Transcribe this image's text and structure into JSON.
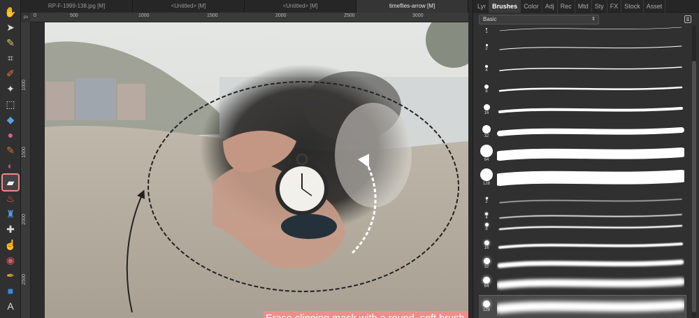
{
  "toolbar": {
    "tools": [
      {
        "name": "view-tool",
        "icon": "hand-icon",
        "glyph": "✋"
      },
      {
        "name": "move-tool",
        "icon": "move-pointer-icon",
        "glyph": "➤"
      },
      {
        "name": "color-picker-tool",
        "icon": "eyedropper-icon",
        "glyph": "✎"
      },
      {
        "name": "crop-tool",
        "icon": "crop-icon",
        "glyph": "⌗"
      },
      {
        "name": "selection-brush-tool",
        "icon": "selection-brush-icon",
        "glyph": "✐"
      },
      {
        "name": "flood-select-tool",
        "icon": "magic-wand-icon",
        "glyph": "✦"
      },
      {
        "name": "marquee-tool",
        "icon": "marquee-icon",
        "glyph": "⬚"
      },
      {
        "name": "flood-fill-tool",
        "icon": "paint-bucket-icon",
        "glyph": "◆"
      },
      {
        "name": "gradient-tool",
        "icon": "gradient-wheel-icon",
        "glyph": "●"
      },
      {
        "name": "paint-brush-tool",
        "icon": "paint-brush-icon",
        "glyph": "✎"
      },
      {
        "name": "color-replacement-tool",
        "icon": "color-replace-icon",
        "glyph": "◐"
      },
      {
        "name": "erase-brush-tool",
        "icon": "eraser-icon",
        "glyph": "▰"
      },
      {
        "name": "burn-tool",
        "icon": "flame-icon",
        "glyph": "♨"
      },
      {
        "name": "clone-tool",
        "icon": "stamp-icon",
        "glyph": "♜"
      },
      {
        "name": "blemish-removal-tool",
        "icon": "bandage-icon",
        "glyph": "✚"
      },
      {
        "name": "smudge-tool",
        "icon": "finger-icon",
        "glyph": "☝"
      },
      {
        "name": "red-eye-tool",
        "icon": "eye-brush-icon",
        "glyph": "◉"
      },
      {
        "name": "pen-tool",
        "icon": "pen-nib-icon",
        "glyph": "✒"
      },
      {
        "name": "shape-tool",
        "icon": "rectangle-shape-icon",
        "glyph": "■"
      },
      {
        "name": "text-tool",
        "icon": "text-icon",
        "glyph": "A"
      }
    ],
    "selected_tool": "erase-brush-tool",
    "selected_color": "#ec8a8a"
  },
  "tabs": [
    {
      "label": "RP-F-1999-138.jpg [M]",
      "active": false
    },
    {
      "label": "<Untitled> [M]",
      "active": false
    },
    {
      "label": "<Untitled> [M]",
      "active": false
    },
    {
      "label": "timeflies-arrow [M]",
      "active": true
    }
  ],
  "rulers": {
    "unit": "px",
    "top_labels": [
      "0",
      "500",
      "1000",
      "1500",
      "2000",
      "2500",
      "3000"
    ],
    "left_labels": [
      "1000",
      "1500",
      "2000",
      "2500"
    ]
  },
  "annotation": {
    "text": "Erase clipping mask with a round, soft brush",
    "color": "#ef8d8d"
  },
  "panel": {
    "tabs": [
      {
        "label": "Lyr",
        "active": false
      },
      {
        "label": "Brushes",
        "active": true
      },
      {
        "label": "Color",
        "active": false
      },
      {
        "label": "Adj",
        "active": false
      },
      {
        "label": "Rec",
        "active": false
      },
      {
        "label": "Mtd",
        "active": false
      },
      {
        "label": "Sty",
        "active": false
      },
      {
        "label": "FX",
        "active": false
      },
      {
        "label": "Stock",
        "active": false
      },
      {
        "label": "Asset",
        "active": false
      }
    ],
    "category": "Basic",
    "brushes": [
      {
        "size": "1",
        "softness": "hard",
        "selected": false
      },
      {
        "size": "2",
        "softness": "hard",
        "selected": false
      },
      {
        "size": "4",
        "softness": "hard",
        "selected": false
      },
      {
        "size": "8",
        "softness": "hard",
        "selected": false
      },
      {
        "size": "16",
        "softness": "hard",
        "selected": false
      },
      {
        "size": "32",
        "softness": "hard",
        "selected": false
      },
      {
        "size": "64",
        "softness": "hard",
        "selected": false
      },
      {
        "size": "128",
        "softness": "hard",
        "selected": false
      },
      {
        "size": "2",
        "softness": "soft",
        "selected": false
      },
      {
        "size": "4",
        "softness": "soft",
        "selected": false
      },
      {
        "size": "8",
        "softness": "soft",
        "selected": false
      },
      {
        "size": "16",
        "softness": "soft",
        "selected": false
      },
      {
        "size": "32",
        "softness": "soft",
        "selected": false
      },
      {
        "size": "64",
        "softness": "soft",
        "selected": false
      },
      {
        "size": "128",
        "softness": "soft",
        "selected": true
      }
    ]
  }
}
